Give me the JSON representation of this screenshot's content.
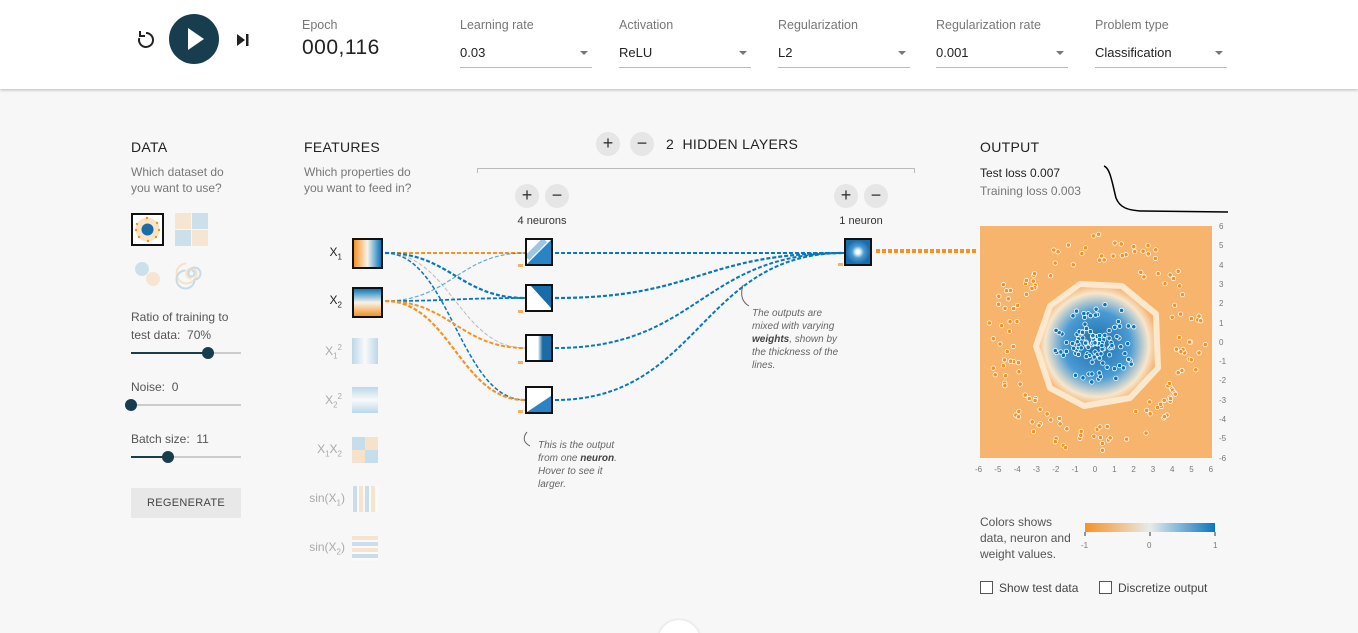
{
  "controls": {
    "reset_icon": "reset-icon",
    "play_icon": "play-icon",
    "step_icon": "step-forward-icon",
    "epoch_label": "Epoch",
    "epoch_value": "000,116",
    "learning_rate": {
      "label": "Learning rate",
      "value": "0.03"
    },
    "activation": {
      "label": "Activation",
      "value": "ReLU"
    },
    "regularization": {
      "label": "Regularization",
      "value": "L2"
    },
    "regularization_rate": {
      "label": "Regularization rate",
      "value": "0.001"
    },
    "problem_type": {
      "label": "Problem type",
      "value": "Classification"
    }
  },
  "data_panel": {
    "title": "DATA",
    "subtitle_line1": "Which dataset do",
    "subtitle_line2": "you want to use?",
    "datasets": [
      "circle",
      "xor",
      "gauss",
      "spiral"
    ],
    "selected_dataset": "circle",
    "ratio_label": "Ratio of training to",
    "ratio_label2": "test data:",
    "ratio_value": "70%",
    "ratio_fraction": 0.7,
    "noise_label": "Noise:",
    "noise_value": "0",
    "noise_fraction": 0.0,
    "batch_label": "Batch size:",
    "batch_value": "11",
    "batch_fraction": 0.34,
    "regenerate_label": "REGENERATE"
  },
  "features_panel": {
    "title": "FEATURES",
    "subtitle_line1": "Which properties do",
    "subtitle_line2": "you want to feed in?",
    "features": [
      {
        "base": "X",
        "sub": "1",
        "sup": "",
        "active": true
      },
      {
        "base": "X",
        "sub": "2",
        "sup": "",
        "active": true
      },
      {
        "base": "X",
        "sub": "1",
        "sup": "2",
        "active": false
      },
      {
        "base": "X",
        "sub": "2",
        "sup": "2",
        "active": false
      },
      {
        "base": "X",
        "sub": "1",
        "sup": "",
        "base2": "X",
        "sub2": "2",
        "active": false
      },
      {
        "base": "sin(X",
        "sub": "1",
        "sup": "",
        "tail": ")",
        "active": false
      },
      {
        "base": "sin(X",
        "sub": "2",
        "sup": "",
        "tail": ")",
        "active": false
      }
    ]
  },
  "network": {
    "layers_count": "2",
    "layers_label": "HIDDEN LAYERS",
    "plus": "+",
    "minus": "−",
    "layer1_count_label": "4 neurons",
    "layer2_count_label": "1 neuron",
    "annotation_neuron": {
      "pre": "This is the output from one ",
      "bold": "neuron",
      "post": ". Hover to see it larger."
    },
    "annotation_weights": {
      "pre": "The outputs are mixed with varying ",
      "bold": "weights",
      "post": ", shown by the thickness of the lines."
    }
  },
  "output_panel": {
    "title": "OUTPUT",
    "test_loss": "Test loss 0.007",
    "training_loss": "Training loss 0.003",
    "y_ticks": [
      "6",
      "5",
      "4",
      "3",
      "2",
      "1",
      "0",
      "-1",
      "-2",
      "-3",
      "-4",
      "-5",
      "-6"
    ],
    "x_ticks": [
      "-6",
      "-5",
      "-4",
      "-3",
      "-2",
      "-1",
      "0",
      "1",
      "2",
      "3",
      "4",
      "5",
      "6"
    ],
    "legend_line1": "Colors shows",
    "legend_line2": "data, neuron and",
    "legend_line3": "weight values.",
    "scale_min": "-1",
    "scale_mid": "0",
    "scale_max": "1",
    "show_test_data": "Show test data",
    "discretize_output": "Discretize output"
  },
  "colors": {
    "orange": "#f59322",
    "blue": "#0877bd",
    "dark": "#183d4e"
  }
}
